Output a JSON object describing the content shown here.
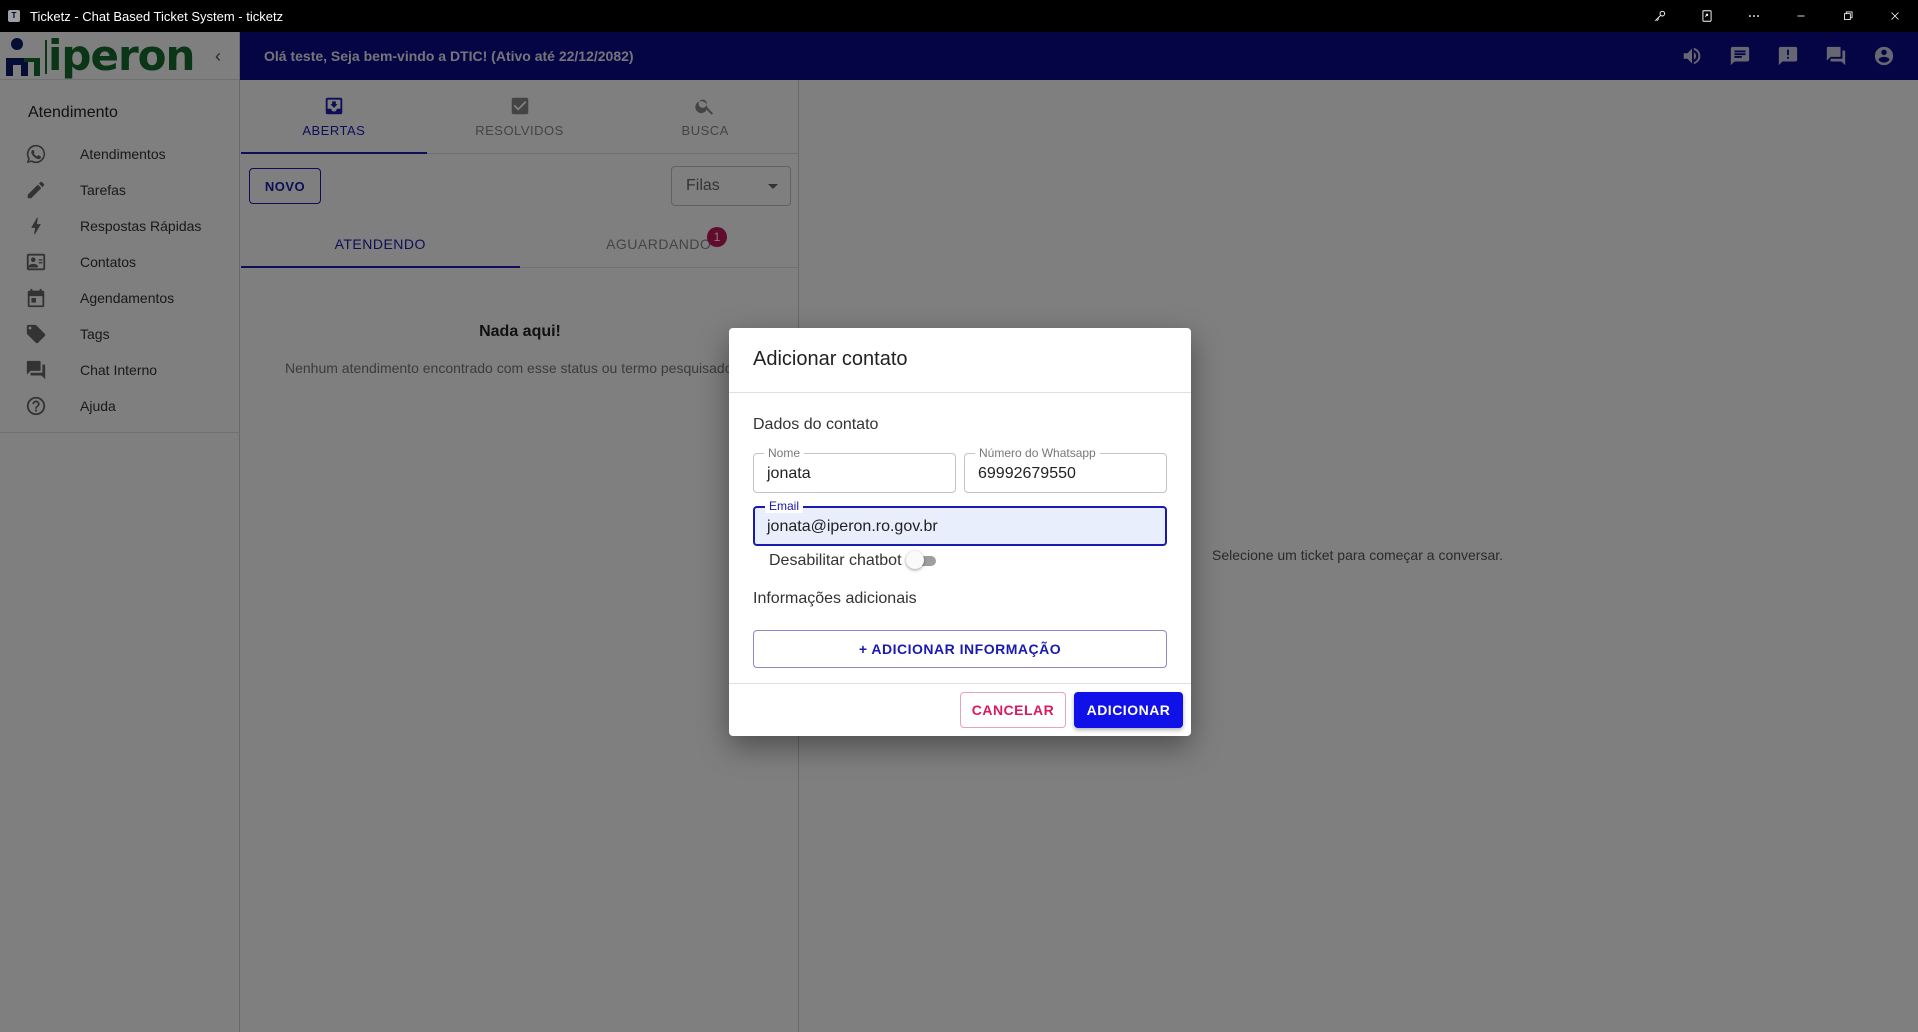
{
  "window": {
    "title": "Ticketz - Chat Based Ticket System - ticketz",
    "app_icon_letter": "T"
  },
  "header": {
    "greeting": "Olá teste, Seja bem-vindo a DTIC! (Ativo até 22/12/2082)",
    "background_color": "#0a0a8a"
  },
  "sidebar": {
    "logo_text": "iperon",
    "section_title": "Atendimento",
    "items": [
      {
        "label": "Atendimentos",
        "icon": "whatsapp-icon"
      },
      {
        "label": "Tarefas",
        "icon": "pencil-icon"
      },
      {
        "label": "Respostas Rápidas",
        "icon": "bolt-icon"
      },
      {
        "label": "Contatos",
        "icon": "contacts-icon"
      },
      {
        "label": "Agendamentos",
        "icon": "calendar-icon"
      },
      {
        "label": "Tags",
        "icon": "tag-icon"
      },
      {
        "label": "Chat Interno",
        "icon": "forum-icon"
      },
      {
        "label": "Ajuda",
        "icon": "help-icon"
      }
    ]
  },
  "tickets": {
    "tabs": [
      {
        "label": "ABERTAS",
        "icon": "move-to-inbox-icon",
        "active": true
      },
      {
        "label": "RESOLVIDOS",
        "icon": "check-box-icon",
        "active": false
      },
      {
        "label": "BUSCA",
        "icon": "search-icon",
        "active": false
      }
    ],
    "new_button": "NOVO",
    "queue_select": "Filas",
    "subtabs": [
      {
        "label": "ATENDENDO",
        "active": true
      },
      {
        "label": "AGUARDANDO",
        "active": false,
        "badge": "1"
      }
    ],
    "empty_title": "Nada aqui!",
    "empty_text": "Nenhum atendimento encontrado com esse status ou termo pesquisado"
  },
  "chat_placeholder": "Selecione um ticket para começar a conversar.",
  "dialog": {
    "title": "Adicionar contato",
    "section_contact": "Dados do contato",
    "name": {
      "label": "Nome",
      "value": "jonata"
    },
    "whatsapp": {
      "label": "Número do Whatsapp",
      "value": "69992679550"
    },
    "email": {
      "label": "Email",
      "value": "jonata@iperon.ro.gov.br"
    },
    "chatbot_toggle": {
      "label": "Desabilitar chatbot",
      "on": false
    },
    "section_extra": "Informações adicionais",
    "add_info_button": "+ ADICIONAR INFORMAÇÃO",
    "cancel_button": "CANCELAR",
    "submit_button": "ADICIONAR"
  },
  "colors": {
    "primary": "#1a1ab0",
    "submit": "#1010e8",
    "cancel": "#d81b60",
    "badge": "#c2185b",
    "logo": "#176b2e"
  }
}
